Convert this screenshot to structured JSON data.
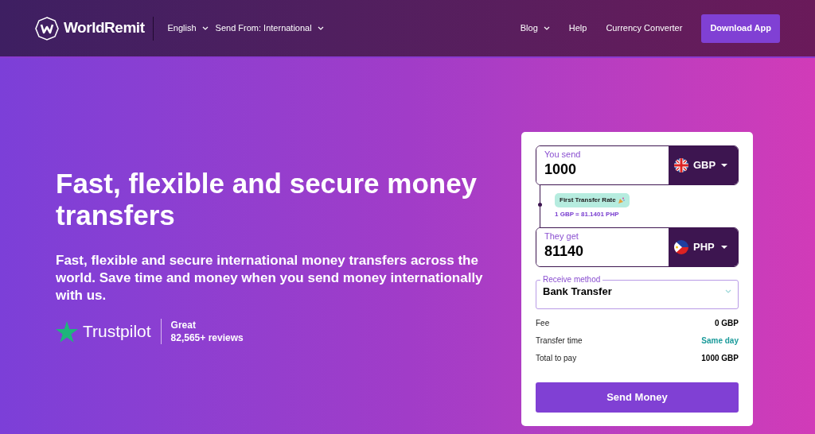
{
  "header": {
    "logo": "WorldRemit",
    "left_nav": [
      {
        "label": "English",
        "dropdown": true
      },
      {
        "label": "Send From: International",
        "dropdown": true
      }
    ],
    "right_nav": [
      {
        "label": "Blog",
        "dropdown": true
      },
      {
        "label": "Help",
        "dropdown": false
      },
      {
        "label": "Currency Converter",
        "dropdown": false
      }
    ],
    "cta": "Download App"
  },
  "hero": {
    "title": "Fast, flexible and secure money transfers",
    "subtitle": "Fast, flexible and secure international money transfers across the world. Save time and money when you send money internationally with us.",
    "trustpilot": {
      "brand": "Trustpilot",
      "rating": "Great",
      "reviews": "82,565+ reviews"
    }
  },
  "calculator": {
    "send": {
      "label": "You send",
      "value": "1000",
      "currency": "GBP"
    },
    "rate_badge": "First Transfer Rate",
    "rate": "1 GBP =  81.1401 PHP",
    "receive": {
      "label": "They get",
      "value": "81140",
      "currency": "PHP"
    },
    "receive_method": {
      "label": "Receive method",
      "value": "Bank Transfer"
    },
    "summary": [
      {
        "label": "Fee",
        "value": "0 GBP",
        "kind": "plain"
      },
      {
        "label": "Transfer time",
        "value": "Same day",
        "kind": "accent"
      },
      {
        "label": "Total to pay",
        "value": "1000 GBP",
        "kind": "plain"
      }
    ],
    "button": "Send Money"
  }
}
